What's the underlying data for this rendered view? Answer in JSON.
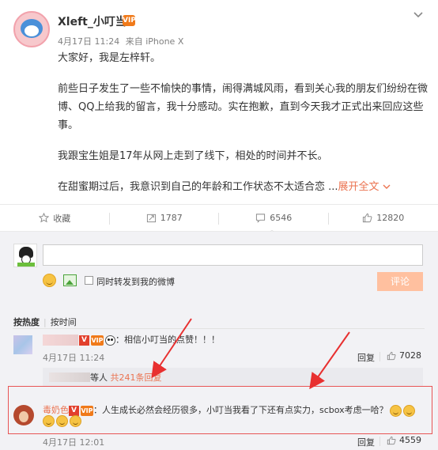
{
  "post": {
    "username": "Xleft_小叮当",
    "vip_badge": "VIP",
    "date": "4月17日 11:24",
    "source": "来自 iPhone X",
    "paragraphs": [
      "大家好，我是左梓轩。",
      "前些日子发生了一些不愉快的事情，闹得满城风雨，看到关心我的朋友们纷纷在微博、QQ上给我的留言，我十分感动。实在抱歉，直到今天我才正式出来回应这些事。",
      "我跟宝生姐是17年从网上走到了线下，相处的时间并不长。",
      "在甜蜜期过后，我意识到自己的年龄和工作状态不太适合恋 ..."
    ],
    "expand_label": "展开全文"
  },
  "actions": {
    "favorite": "收藏",
    "repost": "1787",
    "comment": "6546",
    "like": "12820"
  },
  "compose": {
    "placeholder": "",
    "repost_label": "同时转发到我的微博",
    "submit_label": "评论"
  },
  "sort": {
    "by_hot": "按热度",
    "by_time": "按时间"
  },
  "comments": [
    {
      "text": "：相信小叮当的点赞！！！",
      "time": "4月17日 11:24",
      "reply": "回复",
      "likes": "7028",
      "sub_reply_suffix": "等人",
      "sub_reply_count": "共241条回复"
    },
    {
      "name": "毒奶色",
      "text": "：人生成长必然会经历很多，小叮当我看了下还有点实力，scbox考虑一哈？",
      "time": "4月17日 12:01",
      "reply": "回复",
      "likes": "4559"
    }
  ],
  "colors": {
    "accent": "#eb7350",
    "highlight_border": "#e85555",
    "submit_bg": "#ffc09f",
    "comment_bg": "#f2f2f5"
  }
}
